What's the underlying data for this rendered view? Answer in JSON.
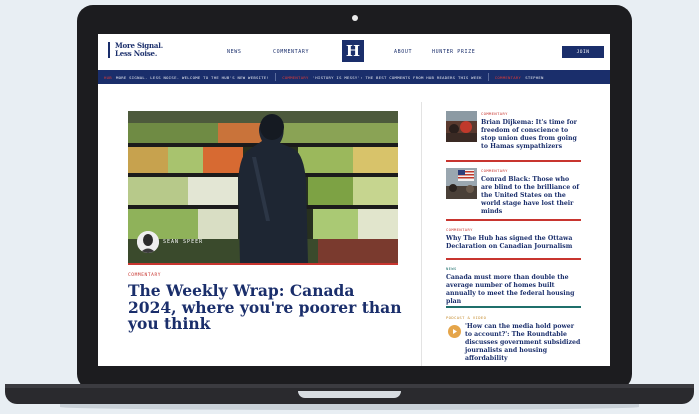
{
  "header": {
    "brand_line1": "More Signal.",
    "brand_line2": "Less Noise.",
    "nav": [
      "NEWS",
      "COMMENTARY",
      "ABOUT",
      "HUNTER PRIZE"
    ],
    "logo_letter": "H",
    "join_label": "JOIN"
  },
  "ticker": [
    {
      "tag": "HUB",
      "text": "MORE SIGNAL. LESS NOISE. WELCOME TO THE HUB'S NEW WEBSITE!"
    },
    {
      "tag": "COMMENTARY",
      "text": "'HISTORY IS MESSY': THE BEST COMMENTS FROM HUB READERS THIS WEEK"
    },
    {
      "tag": "COMMENTARY",
      "text": "STEPHEN"
    }
  ],
  "feature": {
    "kicker": "COMMENTARY",
    "headline": "The Weekly Wrap: Canada 2024, where you're poorer than you think",
    "author": "SEAN SPEER"
  },
  "sidebar": [
    {
      "kicker": "COMMENTARY",
      "title": "Brian Dijkema: It's time for freedom of conscience to stop union dues from going to Hamas sympathizers"
    },
    {
      "kicker": "COMMENTARY",
      "title": "Conrad Black: Those who are blind to the brilliance of the United States on the world stage have lost their minds"
    },
    {
      "kicker": "COMMENTARY",
      "title": "Why The Hub has signed the Ottawa Declaration on Canadian Journalism"
    },
    {
      "kicker": "NEWS",
      "title": "Canada must more than double the average number of homes built annually to meet the federal housing plan"
    },
    {
      "kicker": "PODCAST & VIDEO",
      "title": "'How can the media hold power to account?': The Roundtable discusses government subsidized journalists and housing affordability"
    }
  ],
  "colors": {
    "navy": "#1a2e6b",
    "red": "#c8352f",
    "teal": "#1f6f6b",
    "gold": "#e5a54a"
  }
}
